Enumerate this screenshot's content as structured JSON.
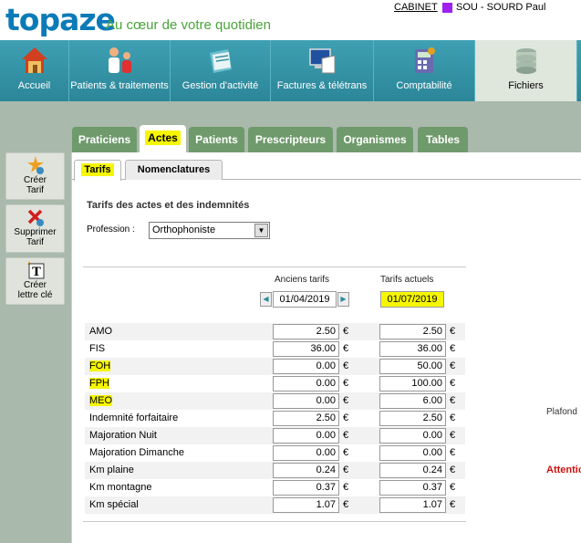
{
  "header": {
    "logo": "topaze",
    "tagline": "Au cœur de votre quotidien",
    "cabinet": "CABINET",
    "user_color": "#a020f0",
    "user": "SOU - SOURD Paul"
  },
  "menu": [
    {
      "label": "Accueil",
      "icon": "house-icon"
    },
    {
      "label": "Patients & traitements",
      "icon": "people-icon"
    },
    {
      "label": "Gestion d'activité",
      "icon": "folder-icon"
    },
    {
      "label": "Factures & télétrans",
      "icon": "computer-icon"
    },
    {
      "label": "Comptabilité",
      "icon": "calculator-icon"
    },
    {
      "label": "Fichiers",
      "icon": "database-icon"
    }
  ],
  "sidebar": [
    {
      "label1": "Créer",
      "label2": "Tarif",
      "icon": "create-icon"
    },
    {
      "label1": "Supprimer",
      "label2": "Tarif",
      "icon": "delete-icon"
    },
    {
      "label1": "Créer",
      "label2": "lettre clé",
      "icon": "letter-t-icon"
    }
  ],
  "tabs": [
    "Praticiens",
    "Actes",
    "Patients",
    "Prescripteurs",
    "Organismes",
    "Tables"
  ],
  "subtabs": [
    "Tarifs",
    "Nomenclatures"
  ],
  "content": {
    "title": "Tarifs des actes et des indemnités",
    "profession_label": "Profession :",
    "profession_value": "Orthophoniste",
    "col_old": "Anciens tarifs",
    "col_new": "Tarifs actuels",
    "date_old": "01/04/2019",
    "date_new": "01/07/2019",
    "currency": "€",
    "plafond": "Plafond",
    "attention": "Attentio"
  },
  "rows": [
    {
      "label": "AMO",
      "old": "2.50",
      "new": "2.50"
    },
    {
      "label": "FIS",
      "old": "36.00",
      "new": "36.00"
    },
    {
      "label": "FOH",
      "old": "0.00",
      "new": "50.00"
    },
    {
      "label": "FPH",
      "old": "0.00",
      "new": "100.00"
    },
    {
      "label": "MEO",
      "old": "0.00",
      "new": "6.00"
    },
    {
      "label": "Indemnité forfaitaire",
      "old": "2.50",
      "new": "2.50"
    },
    {
      "label": "Majoration Nuit",
      "old": "0.00",
      "new": "0.00"
    },
    {
      "label": "Majoration Dimanche",
      "old": "0.00",
      "new": "0.00"
    },
    {
      "label": "Km plaine",
      "old": "0.24",
      "new": "0.24"
    },
    {
      "label": "Km montagne",
      "old": "0.37",
      "new": "0.37"
    },
    {
      "label": "Km spécial",
      "old": "1.07",
      "new": "1.07"
    }
  ]
}
